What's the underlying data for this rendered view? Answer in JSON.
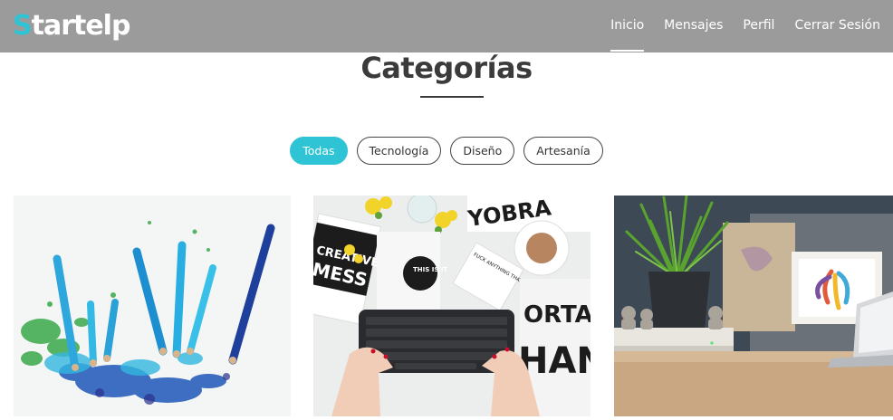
{
  "navbar": {
    "logo_first": "S",
    "logo_rest": "tartelp",
    "links": [
      {
        "label": "Inicio",
        "active": true
      },
      {
        "label": "Mensajes",
        "active": false
      },
      {
        "label": "Perfil",
        "active": false
      },
      {
        "label": "Cerrar Sesión",
        "active": false
      }
    ]
  },
  "section": {
    "title": "Categorías"
  },
  "filters": [
    {
      "label": "Todas",
      "active": true
    },
    {
      "label": "Tecnología",
      "active": false
    },
    {
      "label": "Diseño",
      "active": false
    },
    {
      "label": "Artesanía",
      "active": false
    }
  ],
  "cards": [
    {
      "subject": "colored pencils and shavings"
    },
    {
      "subject": "keyboard on desk with prints",
      "print_texts": [
        "CREATIVE",
        "MESS",
        "THIS IS IT",
        "FUCK ANYTHING THAT DOESN'T MAKE YOU HAPPY",
        "YOBRA",
        "ORTAN",
        "HAN"
      ]
    },
    {
      "subject": "desk with plant, figurines and laptop"
    }
  ],
  "colors": {
    "navbar_bg": "#9b9b9b",
    "accent": "#2ec4d6",
    "title": "#3b3b3b"
  }
}
